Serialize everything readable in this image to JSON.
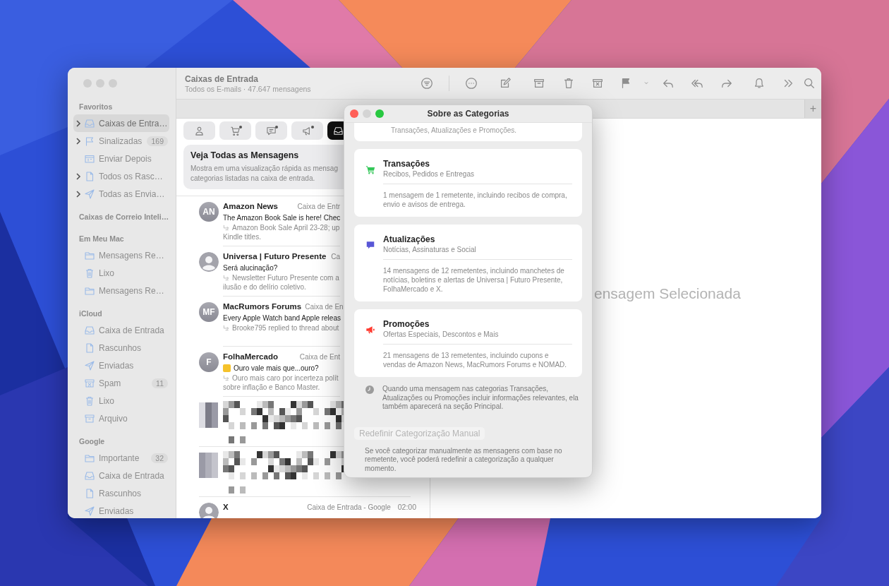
{
  "window": {
    "title": "Caixas de Entrada",
    "subtitle": "Todos os E-mails · 47.647 mensagens"
  },
  "sidebar": {
    "sections": [
      {
        "title": "Favoritos",
        "items": [
          {
            "label": "Caixas de Entra…",
            "kind": "inbox",
            "expandable": true,
            "selected": true
          },
          {
            "label": "Sinalizadas",
            "kind": "flag",
            "expandable": true,
            "selected": false,
            "count": "169"
          },
          {
            "label": "Enviar Depois",
            "kind": "calendar",
            "expandable": false,
            "selected": false
          },
          {
            "label": "Todos os Rasc…",
            "kind": "doc",
            "expandable": true,
            "selected": false
          },
          {
            "label": "Todas as Envia…",
            "kind": "send",
            "expandable": true,
            "selected": false
          }
        ]
      },
      {
        "title": "Caixas de Correio Inteli…"
      },
      {
        "title": "Em Meu Mac",
        "items": [
          {
            "label": "Mensagens Re…",
            "kind": "folder",
            "expandable": false,
            "selected": false
          },
          {
            "label": "Lixo",
            "kind": "trash",
            "expandable": false,
            "selected": false
          },
          {
            "label": "Mensagens Re…",
            "kind": "folder",
            "expandable": false,
            "selected": false
          }
        ]
      },
      {
        "title": "iCloud",
        "items": [
          {
            "label": "Caixa de Entrada",
            "kind": "inbox",
            "expandable": false,
            "selected": false
          },
          {
            "label": "Rascunhos",
            "kind": "doc",
            "expandable": false,
            "selected": false
          },
          {
            "label": "Enviadas",
            "kind": "send",
            "expandable": false,
            "selected": false
          },
          {
            "label": "Spam",
            "kind": "spam",
            "expandable": false,
            "selected": false,
            "count": "11"
          },
          {
            "label": "Lixo",
            "kind": "trash",
            "expandable": false,
            "selected": false
          },
          {
            "label": "Arquivo",
            "kind": "archive",
            "expandable": false,
            "selected": false
          }
        ]
      },
      {
        "title": "Google",
        "items": [
          {
            "label": "Importante",
            "kind": "folder",
            "expandable": false,
            "selected": false,
            "count": "32"
          },
          {
            "label": "Caixa de Entrada",
            "kind": "inbox",
            "expandable": false,
            "selected": false
          },
          {
            "label": "Rascunhos",
            "kind": "doc",
            "expandable": false,
            "selected": false
          },
          {
            "label": "Enviadas",
            "kind": "send",
            "expandable": false,
            "selected": false
          }
        ]
      }
    ]
  },
  "new_tab_button": "+",
  "category_tabs": [
    {
      "kind": "person",
      "selected": false,
      "unread_dot": false
    },
    {
      "kind": "cart",
      "selected": false,
      "unread_dot": true
    },
    {
      "kind": "chat",
      "selected": false,
      "unread_dot": true
    },
    {
      "kind": "megaphone",
      "selected": false,
      "unread_dot": true
    },
    {
      "kind": "inbox",
      "selected": true,
      "unread_dot": false
    }
  ],
  "banner": {
    "title": "Veja Todas as Mensagens",
    "lines": [
      "Mostra em uma visualização rápida as mensag",
      "categorias listadas na caixa de entrada."
    ]
  },
  "messages": [
    {
      "kind": "message",
      "avatar": "AN",
      "sender": "Amazon News",
      "mailbox": "Caixa de Entr",
      "subject": "The Amazon Book Sale is here! Chec",
      "preview": [
        "Amazon Book Sale April 23-28; up",
        "Kindle titles."
      ]
    },
    {
      "kind": "message",
      "sender": "Universa | Futuro Presente",
      "mailbox": "Ca",
      "subject": "Será alucinação?",
      "preview": [
        "Newsletter Futuro Presente com a",
        "ilusão e do delírio coletivo."
      ]
    },
    {
      "kind": "message",
      "avatar": "MF",
      "sender": "MacRumors Forums",
      "mailbox": "Caixa de En",
      "subject": "Every Apple Watch band Apple releas",
      "preview": [
        "Brooke795 replied to thread about"
      ]
    },
    {
      "kind": "message",
      "avatar": "F",
      "sender": "FolhaMercado",
      "mailbox": "Caixa de Ent",
      "color": "#f5c22b",
      "subject": "Ouro vale mais que...ouro?",
      "preview": [
        "Ouro mais caro por incerteza polít",
        "sobre inflação e Banco Master."
      ]
    },
    {
      "kind": "redacted"
    },
    {
      "kind": "redacted"
    },
    {
      "kind": "message",
      "sender": "X",
      "mailbox": "Caixa de Entrada - Google",
      "time": "02:00"
    }
  ],
  "preview_pane": {
    "empty_text": "ensagem Selecionada"
  },
  "dialog": {
    "title": "Sobre as Categorias",
    "intro_tail": "Transações, Atualizações e Promoções.",
    "categories": [
      {
        "kind": "cart",
        "color": "#34c759",
        "title": "Transações",
        "subtitle": "Recibos, Pedidos e Entregas",
        "description": "1 mensagem de 1 remetente, incluindo recibos de compra, envio e avisos de entrega."
      },
      {
        "kind": "chat",
        "color": "#5856d6",
        "title": "Atualizações",
        "subtitle": "Notícias, Assinaturas e Social",
        "description": "14 mensagens de 12 remetentes, incluindo manchetes de notícias, boletins e alertas de Universa | Futuro Presente, FolhaMercado e X."
      },
      {
        "kind": "megaphone",
        "color": "#ff3b30",
        "title": "Promoções",
        "subtitle": "Ofertas Especiais, Descontos e Mais",
        "description": "21 mensagens de 13 remetentes, incluindo cupons e vendas de Amazon News, MacRumors Forums e NOMAD."
      }
    ],
    "note": "Quando uma mensagem nas categorias Transações, Atualizações ou Promoções incluir informações relevantes, ela também aparecerá na seção Principal.",
    "reset_button": {
      "label": "Redefinir Categorização Manual",
      "disabled": true
    },
    "footer": "Se você categorizar manualmente as mensagens com base no remetente, você poderá redefinir a categorização a qualquer momento."
  }
}
